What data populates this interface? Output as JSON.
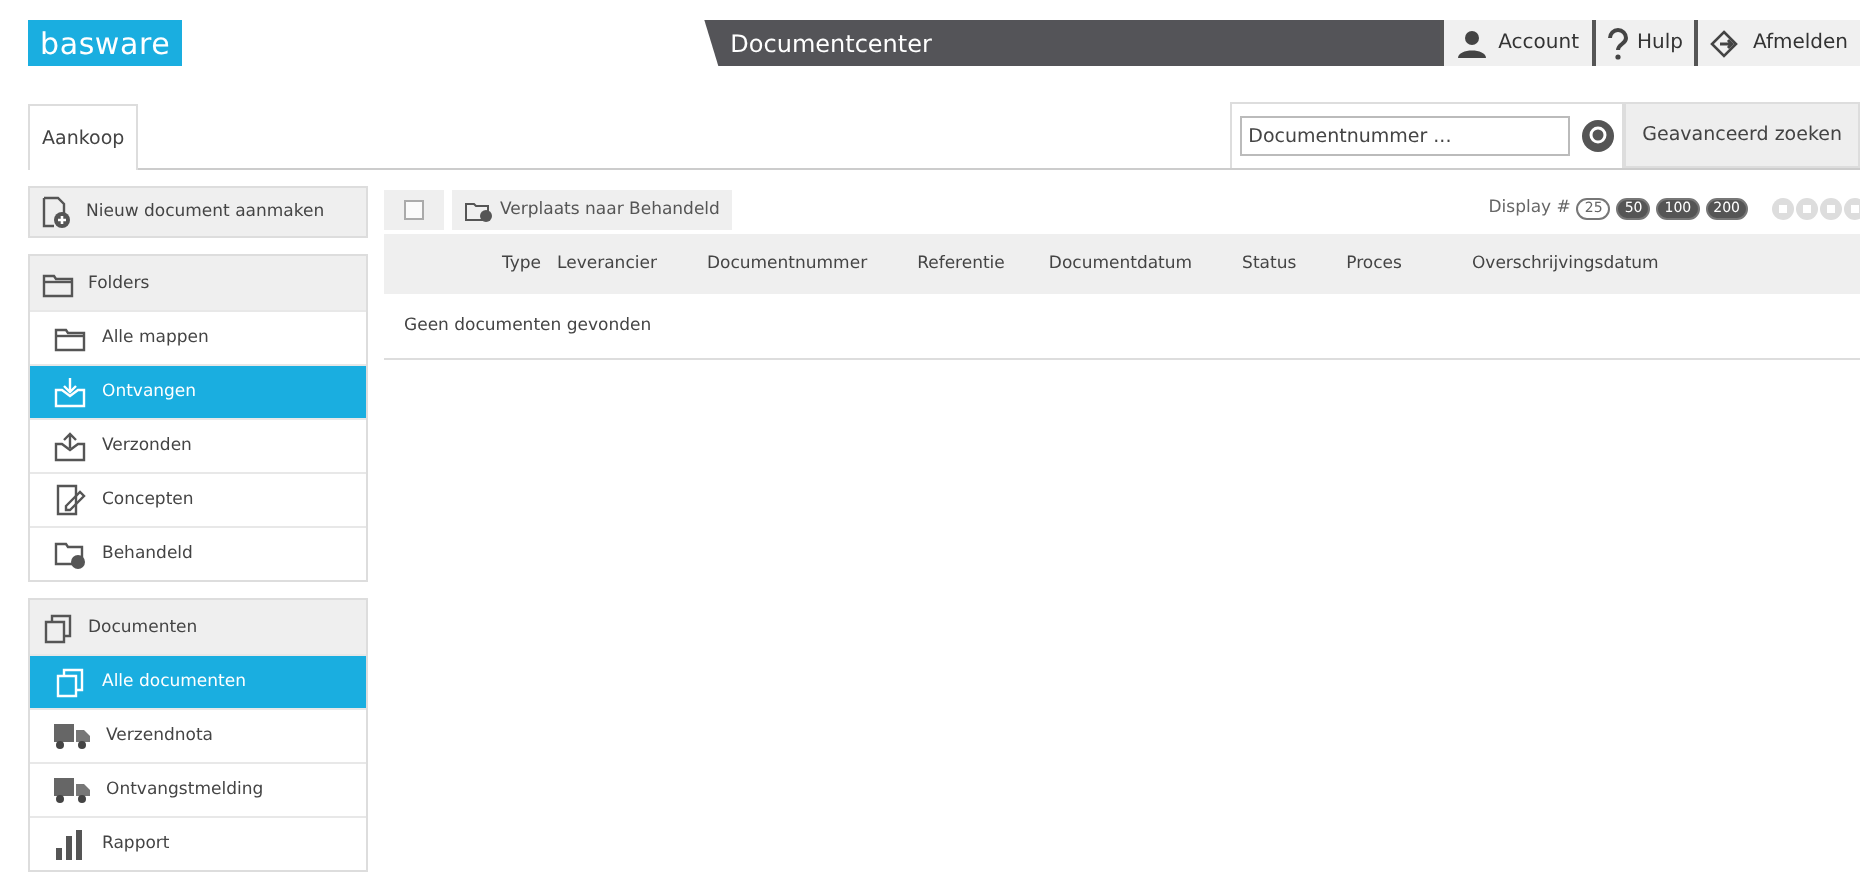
{
  "header": {
    "logo": "basware",
    "title": "Documentcenter",
    "links": [
      "Account",
      "Hulp",
      "Afmelden"
    ]
  },
  "tabs": [
    {
      "label": "Aankoop",
      "selected": true
    }
  ],
  "search": {
    "placeholder": "Documentnummer ...",
    "advanced": "Geavanceerd zoeken"
  },
  "sidebar": {
    "new_document": "Nieuw document aanmaken",
    "groups": [
      {
        "title": "Folders",
        "items": [
          {
            "label": "Alle mappen",
            "selected": false
          },
          {
            "label": "Ontvangen",
            "selected": true
          },
          {
            "label": "Verzonden",
            "selected": false
          },
          {
            "label": "Concepten",
            "selected": false
          },
          {
            "label": "Behandeld",
            "selected": false
          }
        ]
      },
      {
        "title": "Documenten",
        "items": [
          {
            "label": "Alle documenten",
            "selected": true
          },
          {
            "label": "Verzendnota",
            "selected": false
          },
          {
            "label": "Ontvangstmelding",
            "selected": false
          },
          {
            "label": "Rapport",
            "selected": false
          }
        ]
      }
    ]
  },
  "toolbar": {
    "select_all": {
      "checked": false
    },
    "move_button": "Verplaats naar Behandeld",
    "display_label": "Display #",
    "page_sizes": [
      {
        "label": "25",
        "selected": true
      },
      {
        "label": "50",
        "selected": false
      },
      {
        "label": "100",
        "selected": false
      },
      {
        "label": "200",
        "selected": false
      }
    ]
  },
  "table": {
    "columns": [
      "Type",
      "Leverancier",
      "Documentnummer",
      "Referentie",
      "Documentdatum",
      "Status",
      "Proces",
      "Overschrijvingsdatum"
    ],
    "empty_message": "Geen documenten gevonden"
  }
}
